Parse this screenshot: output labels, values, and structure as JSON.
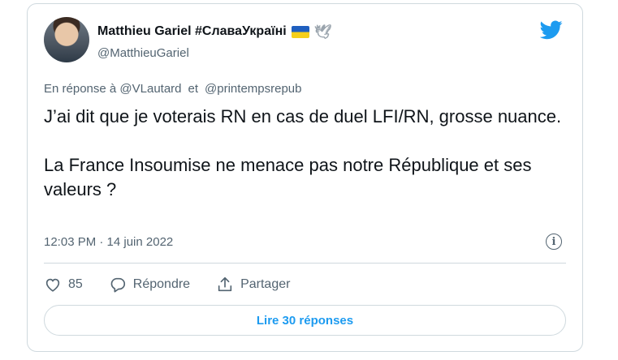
{
  "author": {
    "name": "Matthieu Gariel #СлаваУкраїні",
    "handle": "@MatthieuGariel",
    "flag_icon": "ukraine-flag-icon",
    "dove_icon": "dove-icon"
  },
  "brand": {
    "icon": "twitter-bird-icon",
    "color": "#1d9bf0"
  },
  "reply": {
    "prefix": "En réponse à",
    "mention1": "@VLautard",
    "conjunction": "et",
    "mention2": "@printempsrepub"
  },
  "tweet": {
    "text": "J’ai dit que je voterais RN en cas de duel LFI/RN, grosse nuance.\n\nLa France Insoumise ne menace pas notre République et ses valeurs ?"
  },
  "meta": {
    "timestamp": "12:03 PM · 14 juin 2022"
  },
  "actions": {
    "likes": "85",
    "reply_label": "Répondre",
    "share_label": "Partager"
  },
  "read_replies": {
    "label": "Lire 30 réponses"
  }
}
